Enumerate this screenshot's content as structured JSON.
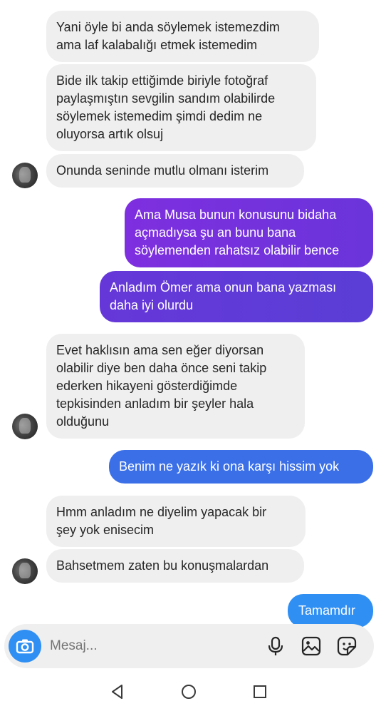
{
  "messages": [
    {
      "id": "m1",
      "from": "them",
      "text": "Yani öyle bi anda söylemek istemezdim\nama laf kalabalığı etmek istemedim"
    },
    {
      "id": "m2",
      "from": "them",
      "text": "Bide ilk takip ettiğimde biriyle fotoğraf\npaylaşmıştın sevgilin sandım olabilirde\nsöylemek istemedim şimdi dedim ne\noluyorsa artık olsuj"
    },
    {
      "id": "m3",
      "from": "them",
      "text": "Onunda seninde mutlu olmanı isterim"
    },
    {
      "id": "m4",
      "from": "me",
      "text": "Ama Musa bunun konusunu bidaha\naçmadıysa şu an bunu bana\nsöylemenden rahatsız olabilir bence"
    },
    {
      "id": "m5",
      "from": "me",
      "text": "Anladım Ömer ama onun bana yazması\ndaha iyi olurdu"
    },
    {
      "id": "m6",
      "from": "them",
      "text": "Evet haklısın ama sen eğer diyorsan\nolabilir diye ben daha önce seni takip\nederken hikayeni gösterdiğimde\ntepkisinden anladım bir şeyler hala\nolduğunu"
    },
    {
      "id": "m7",
      "from": "me",
      "text": "Benim ne yazık ki ona karşı hissim yok"
    },
    {
      "id": "m8",
      "from": "them",
      "text": "Hmm anladım ne diyelim yapacak bir\nşey yok enisecim"
    },
    {
      "id": "m9",
      "from": "them",
      "text": "Bahsetmem zaten bu konuşmalardan"
    },
    {
      "id": "m10",
      "from": "me",
      "text": "Tamamdır"
    }
  ],
  "composer": {
    "placeholder": "Mesaj...",
    "icons": [
      "camera-icon",
      "microphone-icon",
      "gallery-icon",
      "sticker-icon"
    ]
  },
  "navbar": {
    "icons": [
      "back-icon",
      "home-icon",
      "recents-icon"
    ]
  },
  "colors": {
    "incoming_bg": "#efefef",
    "outgoing_purple": "#7a2fe0",
    "outgoing_blue": "#3a6fe8",
    "accent_blue": "#2f8ff3"
  }
}
